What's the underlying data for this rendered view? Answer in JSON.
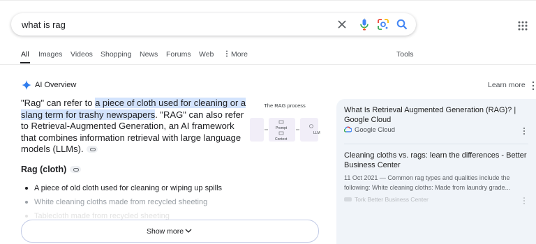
{
  "search": {
    "query": "what is rag"
  },
  "tabs": [
    {
      "label": "All"
    },
    {
      "label": "Images"
    },
    {
      "label": "Videos"
    },
    {
      "label": "Shopping"
    },
    {
      "label": "News"
    },
    {
      "label": "Forums"
    },
    {
      "label": "Web"
    },
    {
      "label": "More"
    },
    {
      "label": "Tools"
    }
  ],
  "ai_overview": {
    "title": "AI Overview",
    "learn_more": "Learn more",
    "para": {
      "p1": "\"Rag\" can refer to ",
      "h1": "a piece of cloth used for cleaning or a slang term for trashy newspapers",
      "p2": ". \"RAG\" can also refer to Retrieval-Augmented Generation, an AI framework that combines information retrieval with large language models (LLMs)."
    },
    "figure_caption": "The RAG process",
    "figure_labels": [
      "Prompt",
      "Context",
      "LLM"
    ],
    "subheading": "Rag (cloth)",
    "bullets": [
      "A piece of old cloth used for cleaning or wiping up spills",
      "White cleaning cloths made from recycled sheeting",
      "Tablecloth made from recycled sheeting"
    ],
    "show_more": "Show more"
  },
  "sources": [
    {
      "title": "What Is Retrieval Augmented Generation (RAG)? | Google Cloud",
      "site": "Google Cloud"
    },
    {
      "title": "Cleaning cloths vs. rags: learn the differences - Better Business Center",
      "snippet": "11 Oct 2021 — Common rag types and qualities include the following: White cleaning cloths: Made from laundry grade...",
      "site": "Tork Better Business Center"
    }
  ],
  "colors": {
    "highlight": "#d3e3fd",
    "panel": "#f0f4f9",
    "accent": "#1a73e8"
  }
}
